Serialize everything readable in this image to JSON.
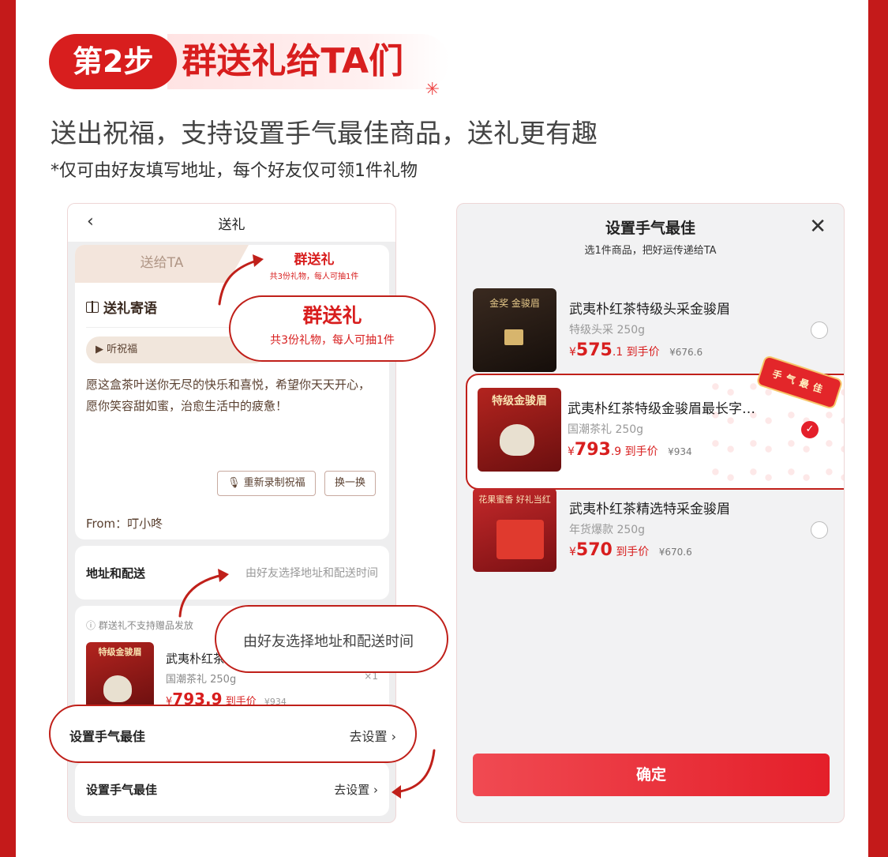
{
  "header": {
    "step_label": "第2步",
    "step_title": "群送礼给TA们",
    "subtitle": "送出祝福，支持设置手气最佳商品，送礼更有趣",
    "note": "*仅可由好友填写地址，每个好友仅可领1件礼物"
  },
  "left_phone": {
    "back": "‹",
    "title": "送礼",
    "tab_inactive": "送给TA",
    "tab_active": "群送礼",
    "tab_active_sub": "共3份礼物，每人可抽1件",
    "section_title": "送礼寄语",
    "listen_label": "▶ 听祝福",
    "message": "愿这盒茶叶送你无尽的快乐和喜悦，希望你天天开心，愿你笑容甜如蜜，治愈生活中的疲惫！",
    "rerecord": "重新录制祝福",
    "swap": "换一换",
    "from": "From：叮小咚",
    "address_label": "地址和配送",
    "address_value": "由好友选择地址和配送时间",
    "product_note": "ⓘ 群送礼不支持赠品发放",
    "product_thumb_label": "特级金骏眉",
    "product_name": "武夷朴红茶",
    "product_spec": "国潮茶礼 250g",
    "product_qty": "×1",
    "product_currency": "¥",
    "product_price": "793.9",
    "product_price_tag": "到手价",
    "product_orig": "¥934",
    "lucky_label": "设置手气最佳",
    "lucky_action": "去设置 ›"
  },
  "callouts": {
    "group_title": "群送礼",
    "group_sub": "共3份礼物，每人可抽1件",
    "address": "由好友选择地址和配送时间",
    "lucky_label": "设置手气最佳",
    "lucky_action": "去设置 ›"
  },
  "right_panel": {
    "title": "设置手气最佳",
    "subtitle": "选1件商品，把好运传递给TA",
    "close": "✕",
    "tag": "手气最佳",
    "confirm": "确定",
    "items": [
      {
        "thumb": "金奖 金骏眉",
        "name": "武夷朴红茶特级头采金骏眉",
        "spec": "特级头采 250g",
        "currency": "¥",
        "price_int": "575",
        "price_dec": ".1",
        "price_tag": "到手价",
        "orig": "¥676.6",
        "selected": false
      },
      {
        "thumb": "特级金骏眉",
        "name": "武夷朴红茶特级金骏眉最长字…",
        "spec": "国潮茶礼 250g",
        "currency": "¥",
        "price_int": "793",
        "price_dec": ".9",
        "price_tag": "到手价",
        "orig": "¥934",
        "selected": true
      },
      {
        "thumb": "花果蜜香 好礼当红",
        "name": "武夷朴红茶精选特采金骏眉",
        "spec": "年货爆款 250g",
        "currency": "¥",
        "price_int": "570",
        "price_dec": "",
        "price_tag": "到手价",
        "orig": "¥670.6",
        "selected": false
      }
    ]
  },
  "colors": {
    "brand_red": "#d81e1e",
    "frame_red": "#c41a1a",
    "accent_gold": "#f6c66a"
  }
}
